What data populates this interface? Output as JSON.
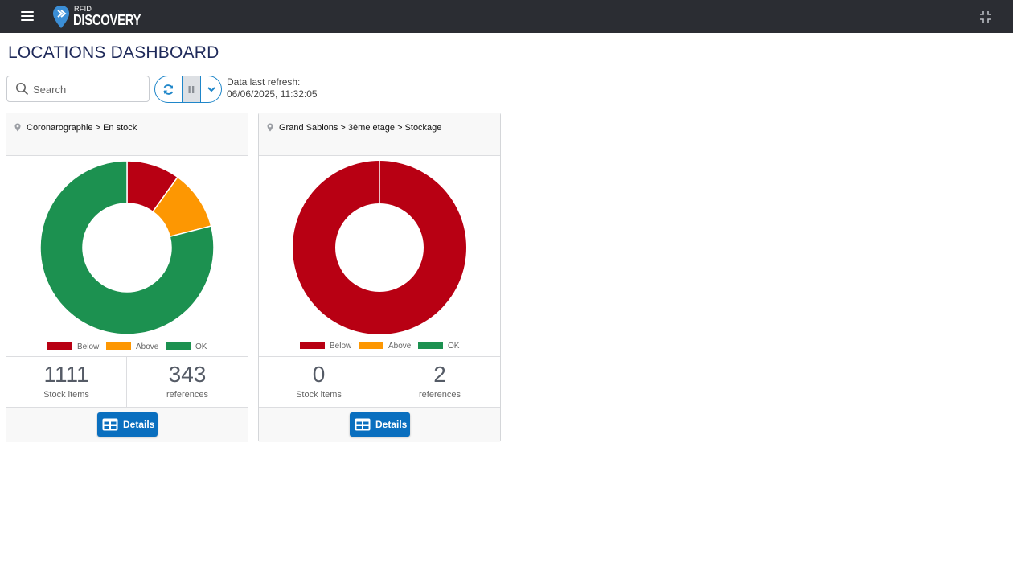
{
  "app": {
    "logo_small": "RFID",
    "logo_large": "DISCOVERY"
  },
  "icons": {
    "menu": "hamburger-menu-icon",
    "collapse": "collapse-icon",
    "search": "search-icon",
    "refresh": "refresh-icon",
    "pause": "pause-icon",
    "more": "chevron-down-icon",
    "location": "location-pin-icon",
    "details": "table-icon"
  },
  "page": {
    "title": "LOCATIONS DASHBOARD"
  },
  "toolbar": {
    "search_placeholder": "Search",
    "refresh_label": "Data last refresh:",
    "refresh_time": "06/06/2025, 11:32:05"
  },
  "colors": {
    "below": "#b80013",
    "above": "#fd9702",
    "ok": "#1c9150",
    "accent": "#0a6fbf",
    "topbar": "#2b2d33"
  },
  "cards": [
    {
      "location": "Coronarographie > En stock",
      "stock_count": "1111",
      "stock_label": "Stock items",
      "ref_count": "343",
      "ref_label": "references",
      "details_label": "Details",
      "legend": [
        "Below",
        "Above",
        "OK"
      ]
    },
    {
      "location": "Grand Sablons > 3ème etage > Stockage",
      "stock_count": "0",
      "stock_label": "Stock items",
      "ref_count": "2",
      "ref_label": "references",
      "details_label": "Details",
      "legend": [
        "Below",
        "Above",
        "OK"
      ]
    }
  ],
  "chart_data": [
    {
      "type": "pie",
      "style": "donut",
      "categories": [
        "Below",
        "Above",
        "OK"
      ],
      "values": [
        34,
        38,
        271
      ],
      "colors": [
        "#b80013",
        "#fd9702",
        "#1c9150"
      ],
      "legend_position": "bottom"
    },
    {
      "type": "pie",
      "style": "donut",
      "categories": [
        "Below",
        "Above",
        "OK"
      ],
      "values": [
        2,
        0,
        0
      ],
      "colors": [
        "#b80013",
        "#fd9702",
        "#1c9150"
      ],
      "legend_position": "bottom"
    }
  ]
}
